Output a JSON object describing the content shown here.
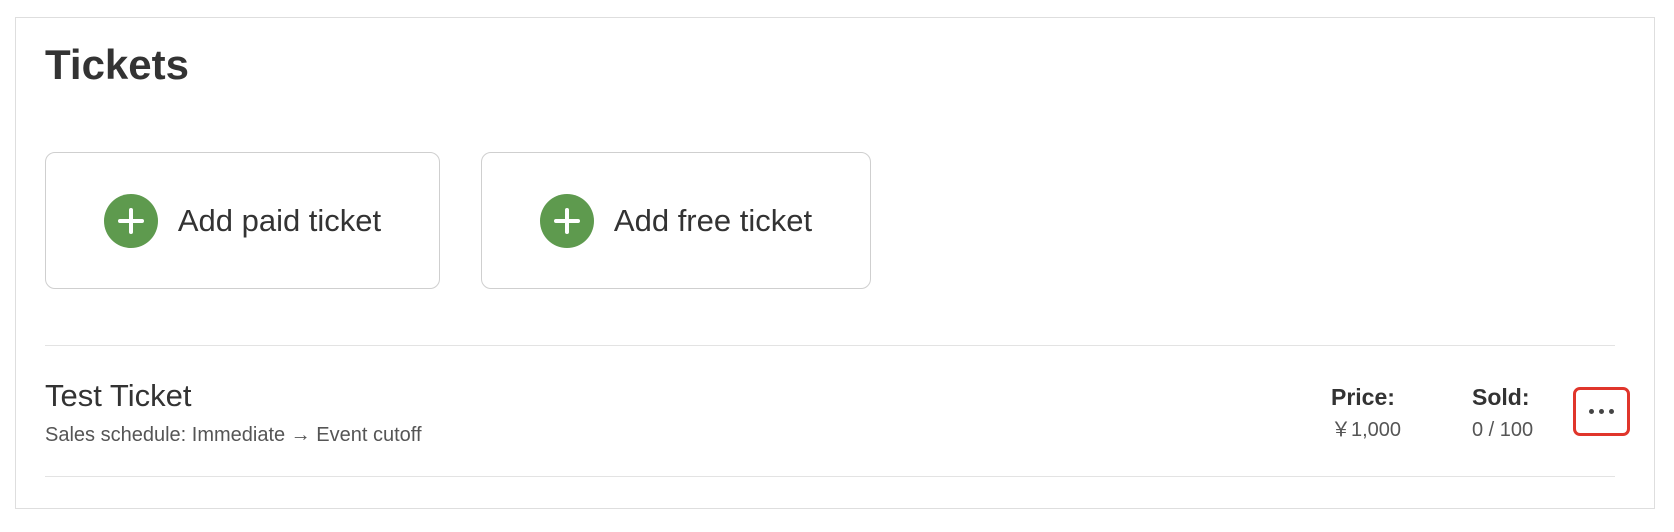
{
  "page": {
    "title": "Tickets"
  },
  "actions": {
    "add_paid_label": "Add paid ticket",
    "add_free_label": "Add free ticket",
    "add_icon": "plus-circle-icon",
    "accent_color": "#5e9a4e"
  },
  "ticket": {
    "name": "Test Ticket",
    "schedule": "Sales schedule: Immediate → Event cutoff",
    "price_label": "Price:",
    "price_value": "￥1,000",
    "sold_label": "Sold:",
    "sold_value": "0 / 100",
    "more_icon": "more-horizontal-icon",
    "highlight_color": "#e0352b"
  }
}
